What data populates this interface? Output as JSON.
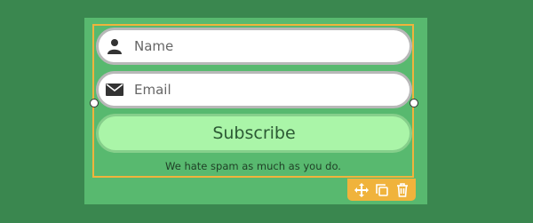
{
  "form": {
    "name_placeholder": "Name",
    "email_placeholder": "Email",
    "subscribe_label": "Subscribe",
    "disclaimer": "We hate spam as much as you do."
  },
  "toolbar": {
    "tools": [
      "move-icon",
      "duplicate-icon",
      "delete-icon"
    ]
  },
  "colors": {
    "background": "#3a874f",
    "card": "#58b96f",
    "button": "#aaf5a8",
    "selection": "#f0b33c"
  }
}
